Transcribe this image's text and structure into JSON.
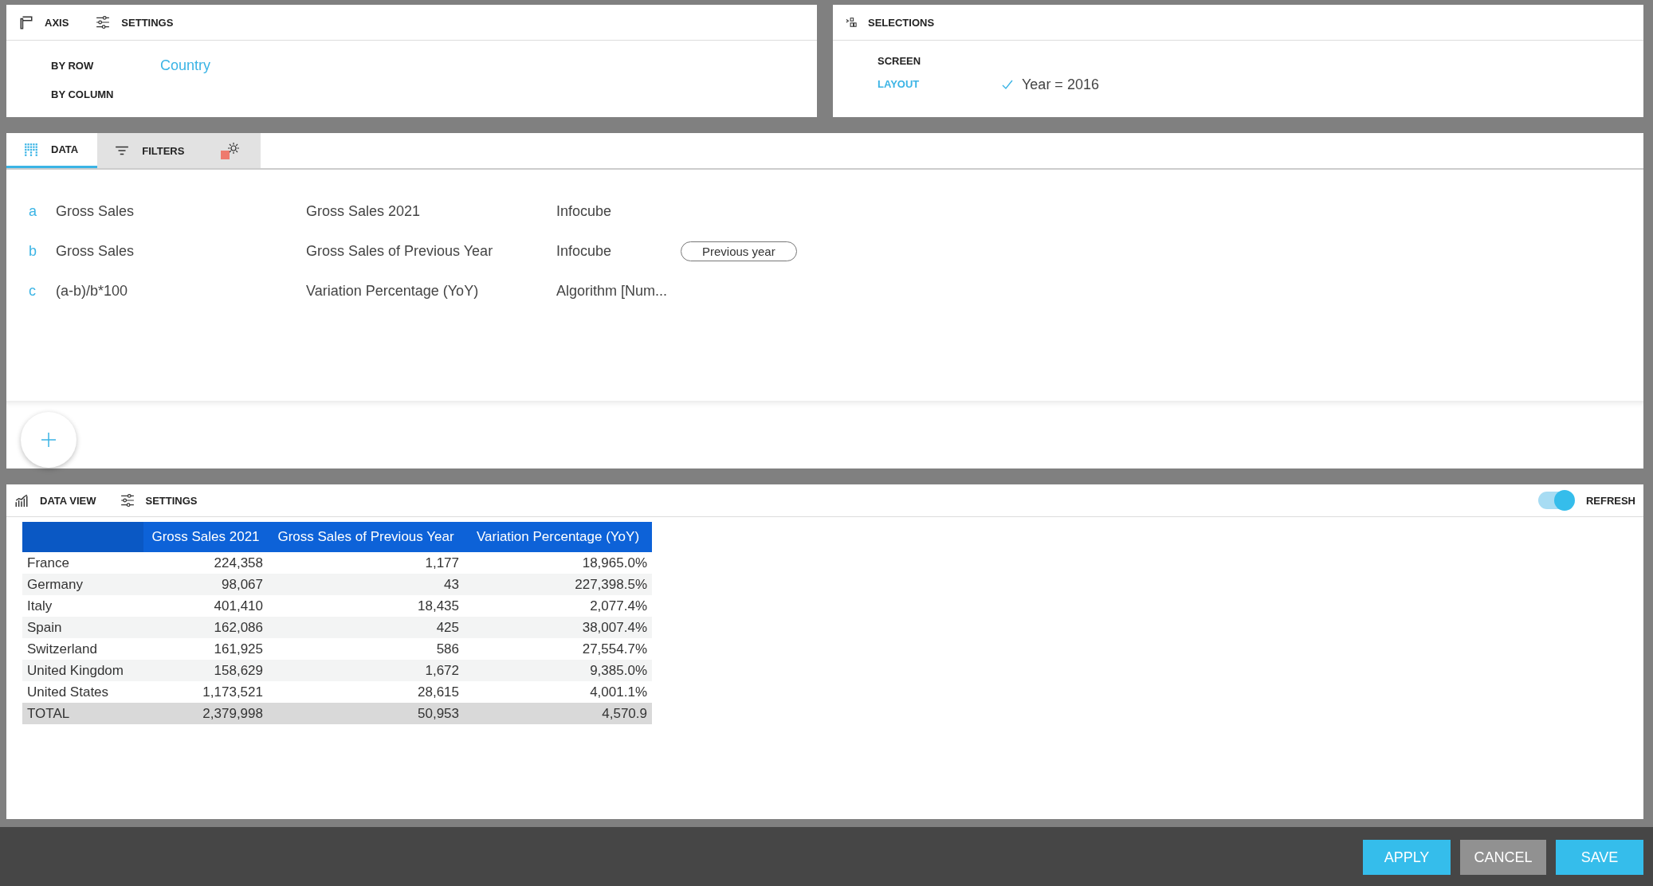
{
  "axis_panel": {
    "tabs": [
      {
        "label": "AXIS",
        "kind": "axis"
      },
      {
        "label": "SETTINGS",
        "kind": "settings"
      }
    ],
    "fields": [
      {
        "label": "BY ROW",
        "value": "Country"
      },
      {
        "label": "BY COLUMN"
      }
    ]
  },
  "selections_panel": {
    "title": "SELECTIONS",
    "items": [
      {
        "label": "SCREEN",
        "selected": false
      },
      {
        "label": "LAYOUT",
        "selected": true
      }
    ],
    "condition": {
      "checked": true,
      "text": "Year = 2016"
    }
  },
  "data_panel": {
    "tabs": [
      {
        "label": "DATA",
        "kind": "data",
        "selected": true
      },
      {
        "label": "FILTERS",
        "kind": "filters",
        "selected": false
      },
      {
        "kind": "gear",
        "selected": false
      }
    ],
    "measures": [
      {
        "letter": "a",
        "formula": "Gross Sales",
        "name": "Gross Sales 2021",
        "source": "Infocube"
      },
      {
        "letter": "b",
        "formula": "Gross Sales",
        "name": "Gross Sales of Previous Year",
        "source": "Infocube",
        "tag": "Previous year"
      },
      {
        "letter": "c",
        "formula": "(a-b)/b*100",
        "name": "Variation Percentage (YoY)",
        "source": "Algorithm [Num..."
      }
    ]
  },
  "data_view": {
    "tabs": [
      {
        "label": "DATA VIEW",
        "kind": "chart"
      },
      {
        "label": "SETTINGS",
        "kind": "settings"
      }
    ],
    "refresh": {
      "label": "REFRESH",
      "on": true
    },
    "table": {
      "columns": [
        "",
        "Gross Sales 2021",
        "Gross Sales of Previous Year",
        "Variation Percentage (YoY)"
      ],
      "rows": [
        [
          "France",
          "224,358",
          "1,177",
          "18,965.0%"
        ],
        [
          "Germany",
          "98,067",
          "43",
          "227,398.5%"
        ],
        [
          "Italy",
          "401,410",
          "18,435",
          "2,077.4%"
        ],
        [
          "Spain",
          "162,086",
          "425",
          "38,007.4%"
        ],
        [
          "Switzerland",
          "161,925",
          "586",
          "27,554.7%"
        ],
        [
          "United Kingdom",
          "158,629",
          "1,672",
          "9,385.0%"
        ],
        [
          "United States",
          "1,173,521",
          "28,615",
          "4,001.1%"
        ]
      ],
      "total": [
        "TOTAL",
        "2,379,998",
        "50,953",
        "4,570.9"
      ]
    }
  },
  "buttons": [
    {
      "label": "APPLY",
      "kind": "primary"
    },
    {
      "label": "CANCEL",
      "kind": "secondary"
    },
    {
      "label": "SAVE",
      "kind": "primary"
    }
  ]
}
